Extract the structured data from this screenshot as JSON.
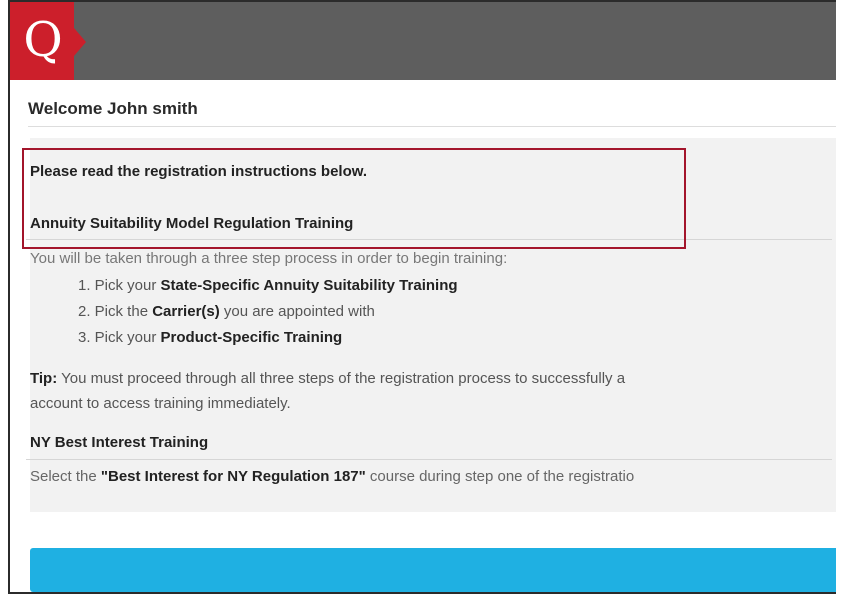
{
  "header": {
    "logo_letter": "Q",
    "logo_color": "#cc1f2b",
    "bar_color": "#5e5e5e"
  },
  "welcome": {
    "text": "Welcome John smith"
  },
  "instructions": {
    "intro": "Please read the registration instructions below.",
    "annuity_title": "Annuity Suitability Model Regulation Training",
    "steps_intro": "You will be taken through a three step process in order to begin training:",
    "steps": [
      {
        "prefix": "1. Pick your ",
        "bold": "State-Specific Annuity Suitability Training",
        "suffix": ""
      },
      {
        "prefix": "2. Pick the ",
        "bold": "Carrier(s)",
        "suffix": " you are appointed with"
      },
      {
        "prefix": "3. Pick your ",
        "bold": "Product-Specific Training",
        "suffix": ""
      }
    ],
    "tip_label": "Tip:",
    "tip_text": " You must proceed through all three steps of the registration process to successfully a",
    "tip_text_2": "account to access training immediately.",
    "ny_title": "NY Best Interest Training",
    "ny_prefix": "Select the ",
    "ny_bold": "\"Best Interest for NY Regulation 187\"",
    "ny_suffix": " course during step one of the registratio"
  },
  "cta": {
    "color": "#1fb0e2"
  },
  "highlight_color": "#a3152b"
}
